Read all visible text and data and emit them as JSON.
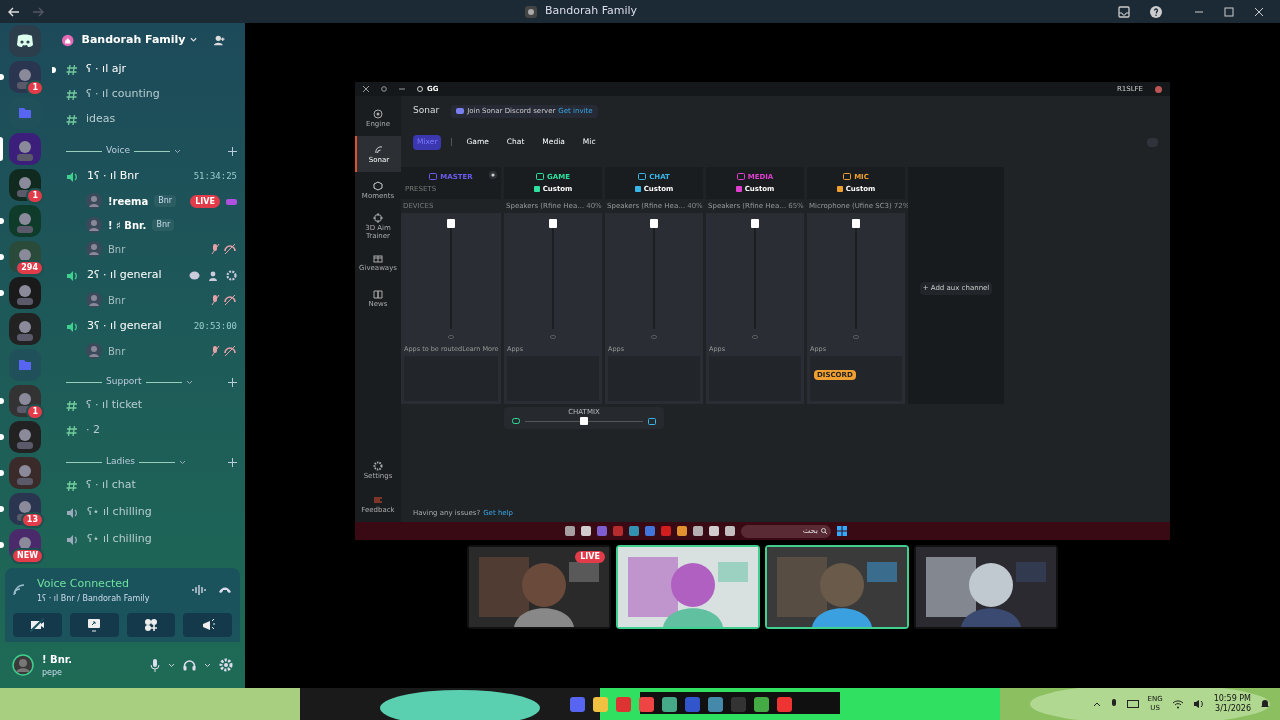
{
  "title_bar": {
    "title": "Bandorah Family"
  },
  "servers": [
    {
      "kind": "discord",
      "selected": false
    },
    {
      "kind": "server",
      "badge": "1",
      "unread": true,
      "selected": false
    },
    {
      "kind": "folder",
      "selected": false
    },
    {
      "kind": "server",
      "unread": false,
      "selected": true
    },
    {
      "kind": "server",
      "badge": "1",
      "unread": false,
      "selected": false
    },
    {
      "kind": "server",
      "unread": true,
      "selected": false
    },
    {
      "kind": "server",
      "badge": "294",
      "unread": true,
      "selected": false
    },
    {
      "kind": "server",
      "unread": true,
      "selected": false
    },
    {
      "kind": "server",
      "unread": false,
      "selected": false
    },
    {
      "kind": "folder",
      "selected": false
    },
    {
      "kind": "server",
      "badge": "1",
      "unread": true,
      "selected": false
    },
    {
      "kind": "server",
      "unread": true,
      "selected": false
    },
    {
      "kind": "server",
      "unread": true,
      "selected": false
    },
    {
      "kind": "server",
      "badge": "13",
      "unread": true,
      "selected": false
    },
    {
      "kind": "server",
      "badge": "NEW",
      "unread": true,
      "selected": false
    }
  ],
  "guild": {
    "name": "Bandorah Family"
  },
  "channels": [
    {
      "kind": "text",
      "name": "ʕ · ıl ajr",
      "unread": true
    },
    {
      "kind": "text",
      "name": "ʕ · ıl counting",
      "unread": false
    },
    {
      "kind": "text",
      "name": "ideas",
      "unread": false
    },
    {
      "kind": "category",
      "name": "Voice"
    },
    {
      "kind": "voice",
      "name": "1ʕ · ıl Bnr",
      "timer": "51:34:25",
      "members": [
        {
          "name": "!reema",
          "tag": "Bnr",
          "live": true,
          "badge": "LIVE",
          "muted": false
        },
        {
          "name": "! ♯ Bnr.",
          "tag": "Bnr",
          "live": false,
          "muted": false
        },
        {
          "name": "Bnr",
          "live": false,
          "muted": true
        }
      ]
    },
    {
      "kind": "voice",
      "name": "2ʕ · ıl general",
      "members": [
        {
          "name": "Bnr",
          "live": false,
          "muted": true
        }
      ]
    },
    {
      "kind": "voice",
      "name": "3ʕ · ıl general",
      "timer": "20:53:00",
      "members": [
        {
          "name": "Bnr",
          "live": false,
          "muted": true
        }
      ]
    },
    {
      "kind": "category",
      "name": "Support"
    },
    {
      "kind": "text",
      "name": "ʕ · ıl ticket",
      "unread": false
    },
    {
      "kind": "text",
      "name": "· 2",
      "unread": false
    },
    {
      "kind": "category",
      "name": "Ladies"
    },
    {
      "kind": "text",
      "name": "ʕ · ıl chat",
      "unread": false
    },
    {
      "kind": "voice",
      "name": "ʕ⋆ ıl chilling"
    },
    {
      "kind": "voice",
      "name": "ʕ⋆ ıl chilling"
    }
  ],
  "voice_panel": {
    "status": "Voice Connected",
    "location": "1ʕ · ıl Bnr / Bandorah Family"
  },
  "user_panel": {
    "name": "! Bnr.",
    "status": "pepe"
  },
  "gg": {
    "title": "GG",
    "account": "R1SLFE",
    "nav": [
      {
        "label": "Engine",
        "selected": false
      },
      {
        "label": "Sonar",
        "selected": true
      },
      {
        "label": "Moments",
        "selected": false
      },
      {
        "label": "3D Aim Trainer",
        "selected": false
      },
      {
        "label": "Giveaways",
        "selected": false
      },
      {
        "label": "News",
        "selected": false
      }
    ],
    "nav_bottom": [
      {
        "label": "Settings"
      },
      {
        "label": "Feedback"
      }
    ],
    "heading": "Sonar",
    "banner": "Join Sonar Discord server",
    "banner_link": "Get invite",
    "tabs": [
      {
        "label": "Mixer",
        "selected": true
      },
      {
        "label": "Game",
        "selected": false
      },
      {
        "label": "Chat",
        "selected": false
      },
      {
        "label": "Media",
        "selected": false
      },
      {
        "label": "Mic",
        "selected": false
      }
    ],
    "mixer": [
      {
        "kind": "master",
        "name": "MASTER",
        "color": "#6a5cf0",
        "presets": "PRESETS",
        "devices": "DEVICES",
        "level": 1,
        "apps_label": "Apps to be routed",
        "apps_link": "Learn More"
      },
      {
        "kind": "channel",
        "name": "GAME",
        "color": "#2fe0a0",
        "preset": "Custom",
        "device": "Speakers (Rfine Hea…",
        "percent": "40%",
        "level": 1,
        "apps_label": "Apps"
      },
      {
        "kind": "channel",
        "name": "CHAT",
        "color": "#38b6e8",
        "preset": "Custom",
        "device": "Speakers (Rfine Hea…",
        "percent": "40%",
        "level": 1,
        "apps_label": "Apps"
      },
      {
        "kind": "channel",
        "name": "MEDIA",
        "color": "#e03fd0",
        "preset": "Custom",
        "device": "Speakers (Rfine Hea…",
        "percent": "65%",
        "level": 1,
        "apps_label": "Apps"
      },
      {
        "kind": "channel",
        "name": "MIC",
        "color": "#f0a030",
        "preset": "Custom",
        "device": "Microphone (Ufine SC3)",
        "percent": "72%",
        "level": 1,
        "apps_label": "Apps",
        "apps": [
          "DISCORD"
        ]
      }
    ],
    "aux_button": "+ Add aux channel",
    "chatmix": {
      "label": "CHATMIX",
      "level": 0.5
    },
    "help": "Having any issues?",
    "help_link": "Get help",
    "taskbar_search": "بحث"
  },
  "streams": [
    {
      "speaking": false,
      "label": "LIVE"
    },
    {
      "speaking": true
    },
    {
      "speaking": true
    },
    {
      "speaking": false
    }
  ],
  "tray": {
    "lang": "ENG",
    "region": "US",
    "time": "10:59 PM",
    "date": "3/1/2026"
  }
}
